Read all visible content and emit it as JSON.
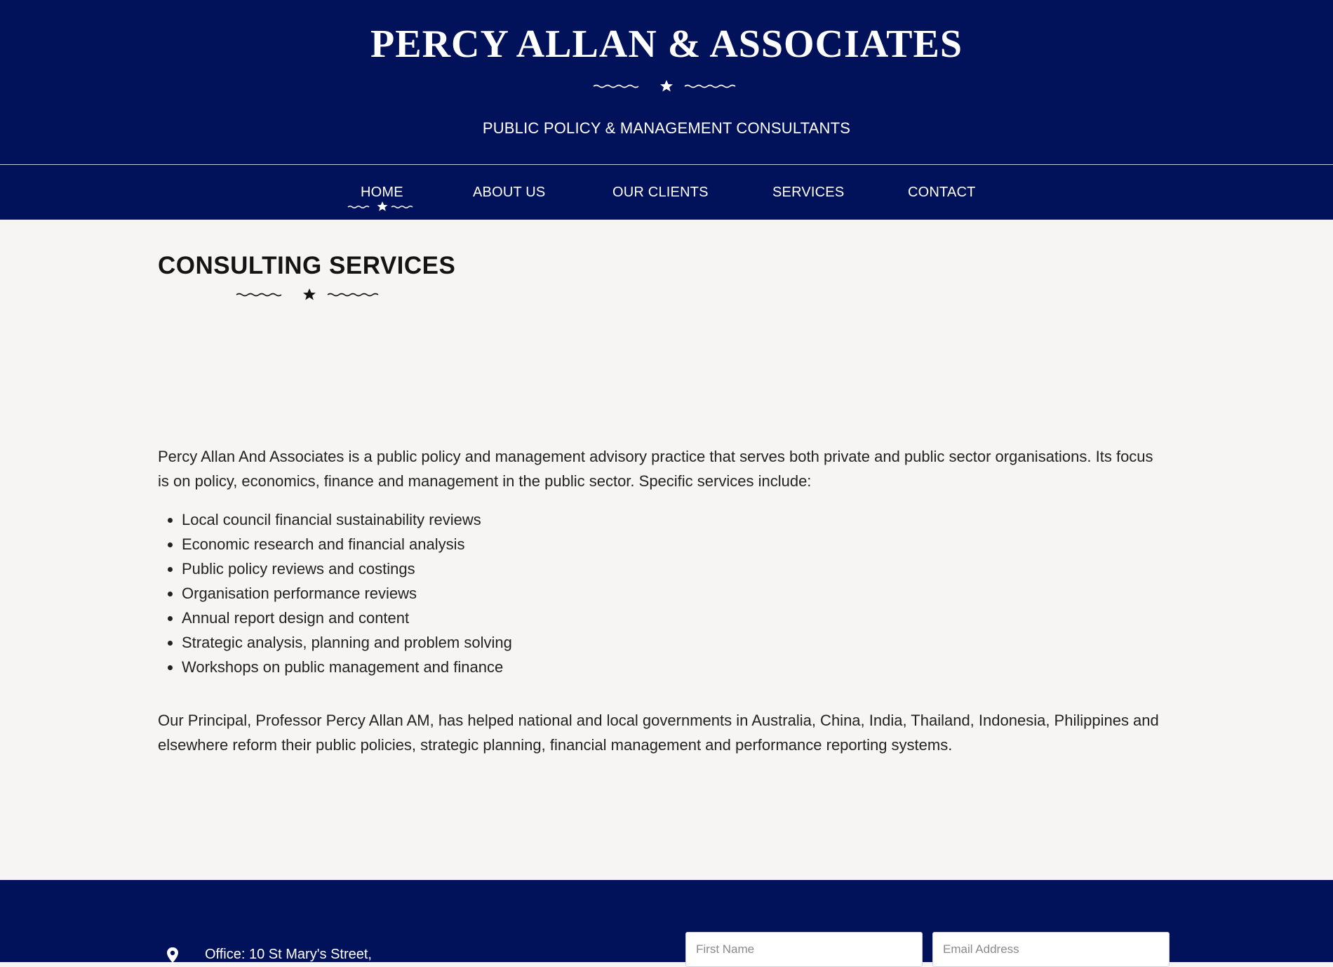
{
  "colors": {
    "header_bg": "#02125a",
    "content_bg": "#f6f5f3",
    "heading_text": "#141414",
    "body_text": "#222222"
  },
  "header": {
    "title": "PERCY ALLAN & ASSOCIATES",
    "tagline": "PUBLIC POLICY & MANAGEMENT CONSULTANTS",
    "ornament_icon": "star-flourish-icon"
  },
  "nav": {
    "items": [
      {
        "label": "HOME",
        "active": true
      },
      {
        "label": "ABOUT US",
        "active": false
      },
      {
        "label": "OUR CLIENTS",
        "active": false
      },
      {
        "label": "SERVICES",
        "active": false
      },
      {
        "label": "CONTACT",
        "active": false
      }
    ]
  },
  "main": {
    "title": "CONSULTING SERVICES",
    "intro": "Percy Allan And Associates is a public policy and management advisory practice that serves both private and public sector organisations. Its focus is on policy, economics, finance and management in the public sector. Specific services include:",
    "services": [
      "Local council financial sustainability reviews",
      "Economic research and financial analysis",
      "Public policy reviews and costings",
      "Organisation performance reviews",
      "Annual report design and content",
      "Strategic analysis, planning and problem solving",
      "Workshops on public management and finance"
    ],
    "principal": "Our Principal, Professor Percy Allan AM, has helped national and local governments in Australia, China, India, Thailand, Indonesia, Philippines and elsewhere reform their public policies, strategic planning, financial management and performance reporting systems."
  },
  "footer": {
    "office": "Office: 10 St Mary's Street,",
    "location_icon": "map-pin-icon",
    "form": {
      "first_name_placeholder": "First Name",
      "email_placeholder": "Email Address"
    }
  }
}
